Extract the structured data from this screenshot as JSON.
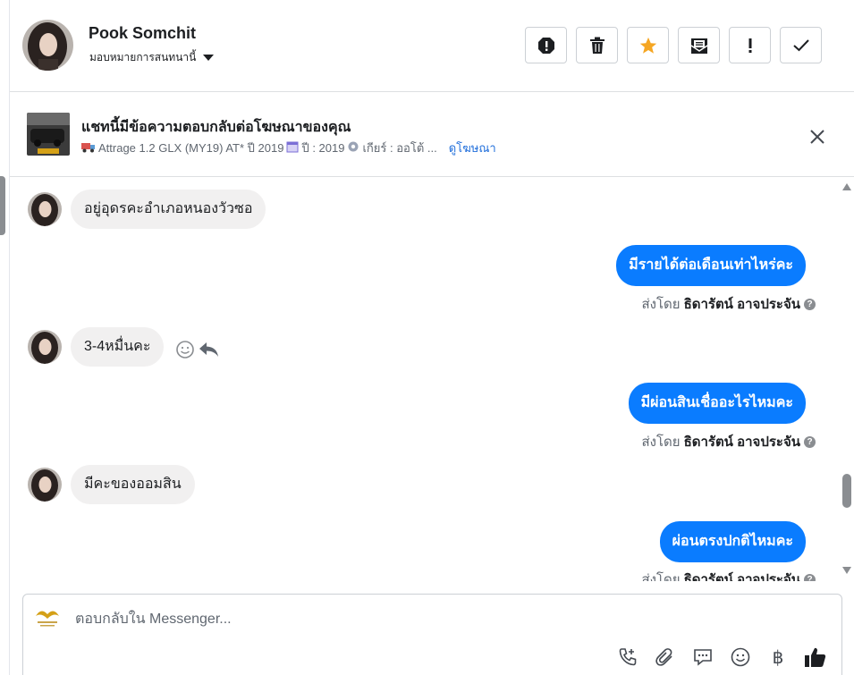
{
  "header": {
    "contact_name": "Pook Somchit",
    "assign_label": "มอบหมายการสนทนานี้",
    "actions": [
      {
        "name": "report-spam-button",
        "icon": "alert-octagon-icon"
      },
      {
        "name": "delete-button",
        "icon": "trash-icon"
      },
      {
        "name": "star-button",
        "icon": "star-icon",
        "color": "#f5a623"
      },
      {
        "name": "mark-unread-button",
        "icon": "envelope-open-icon"
      },
      {
        "name": "follow-up-button",
        "icon": "exclamation-icon"
      },
      {
        "name": "mark-done-button",
        "icon": "check-icon"
      }
    ]
  },
  "ad": {
    "title": "แชทนี้มีข้อความตอบกลับต่อโฆษณาของคุณ",
    "desc_car": "Attrage 1.2 GLX (MY19) AT* ปี 2019",
    "desc_year": "ปี : 2019",
    "desc_gear": "เกียร์ : ออโต้ ...",
    "link_label": "ดูโฆษณา"
  },
  "messages": {
    "m1": "อยู่อุดรคะอำเภอหนองวัวซอ",
    "m2": "มีรายได้ต่อเดือนเท่าไหร่คะ",
    "m3": "3-4หมื่นคะ",
    "m4": "มีผ่อนสินเชื่ออะไรไหมคะ",
    "m5": "มีคะของออมสิน",
    "m6": "ผ่อนตรงปกติไหมคะ"
  },
  "sent_by": {
    "prefix": "ส่งโดย",
    "agent": "ธิดารัตน์ อาจประจัน",
    "help": "?"
  },
  "composer": {
    "placeholder": "ตอบกลับใน Messenger...",
    "value": "",
    "baht": "฿"
  },
  "colors": {
    "outgoing_bubble": "#0a7cff",
    "incoming_bubble": "#f1f0f0",
    "link": "#216fdb",
    "star": "#f5a623"
  }
}
